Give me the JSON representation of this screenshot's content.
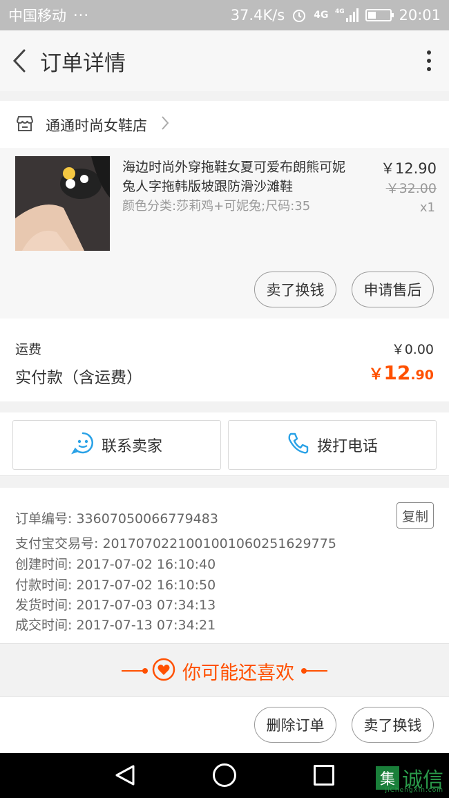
{
  "status_bar": {
    "carrier": "中国移动",
    "dots": "···",
    "speed": "37.4K/s",
    "network_1": "4G",
    "network_2": "4G",
    "time": "20:01"
  },
  "header": {
    "title": "订单详情"
  },
  "shop": {
    "name": "通通时尚女鞋店"
  },
  "product": {
    "name": "海边时尚外穿拖鞋女夏可爱布朗熊可妮兔人字拖韩版坡跟防滑沙滩鞋",
    "attributes": "颜色分类:莎莉鸡+可妮兔;尺码:35",
    "price": "￥12.90",
    "original_price": "￥32.00",
    "quantity": "x1",
    "btn_sell": "卖了换钱",
    "btn_after_sale": "申请售后"
  },
  "fees": {
    "shipping_label": "运费",
    "shipping_value": "￥0.00",
    "paid_label": "实付款（含运费）",
    "paid_currency": "￥",
    "paid_int": "12",
    "paid_dec": ".90"
  },
  "contact": {
    "seller_label": "联系卖家",
    "phone_label": "拨打电话"
  },
  "order_info": {
    "order_no": "订单编号: 336070500667794​83",
    "copy_label": "复制",
    "alipay_no": "支付宝交易号: 2017070221001001060251629775",
    "created": "创建时间: 2017-07-02 16:10:40",
    "paid": "付款时间: 2017-07-02 16:10:50",
    "shipped": "发货时间: 2017-07-03 07:34:13",
    "completed": "成交时间: 2017-07-13 07:34:21"
  },
  "recommend": {
    "label": "你可能还喜欢"
  },
  "actions": {
    "delete_label": "删除订单",
    "sell_label": "卖了换钱"
  },
  "watermark": {
    "logo_char": "集",
    "text": "诚信",
    "sub": "JiChengXin.com"
  },
  "colors": {
    "accent": "#ff5000",
    "status_bar": "#bdbdbd",
    "contact_icon": "#29a1e6"
  }
}
